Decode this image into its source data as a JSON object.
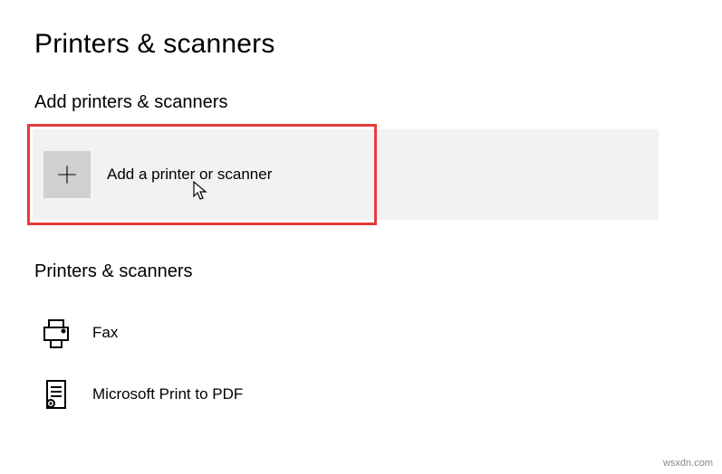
{
  "page": {
    "title": "Printers & scanners"
  },
  "sections": {
    "add": {
      "heading": "Add printers & scanners",
      "action_label": "Add a printer or scanner"
    },
    "devices": {
      "heading": "Printers & scanners",
      "items": [
        {
          "name": "Fax",
          "icon": "fax-icon"
        },
        {
          "name": "Microsoft Print to PDF",
          "icon": "pdf-printer-icon"
        }
      ]
    }
  },
  "watermark": "wsxdn.com"
}
